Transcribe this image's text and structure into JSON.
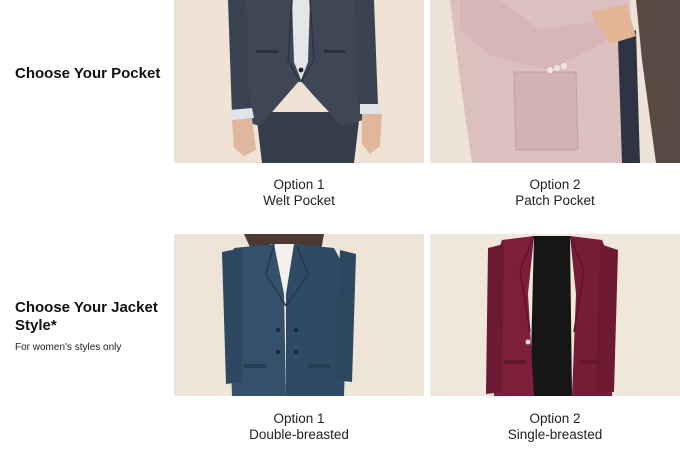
{
  "pocket_section": {
    "title": "Choose Your Pocket",
    "options": [
      {
        "number": "Option 1",
        "name": "Welt Pocket",
        "image": "man-navy-suit-welt-pocket-photo"
      },
      {
        "number": "Option 2",
        "name": "Patch Pocket",
        "image": "pink-blazer-patch-pocket-photo"
      }
    ]
  },
  "jacket_section": {
    "title": "Choose Your Jacket Style*",
    "note": "For women's styles only",
    "options": [
      {
        "number": "Option 1",
        "name": "Double-breasted",
        "image": "woman-navy-double-breasted-jacket-photo"
      },
      {
        "number": "Option 2",
        "name": "Single-breasted",
        "image": "woman-burgundy-single-breasted-jacket-photo"
      }
    ]
  },
  "colors": {
    "photo_background": "#efe6dc",
    "navy_suit": "#3f4756",
    "pink_blazer": "#dcc0c0",
    "navy_jacket": "#34506b",
    "burgundy_jacket": "#7d1f3a"
  }
}
